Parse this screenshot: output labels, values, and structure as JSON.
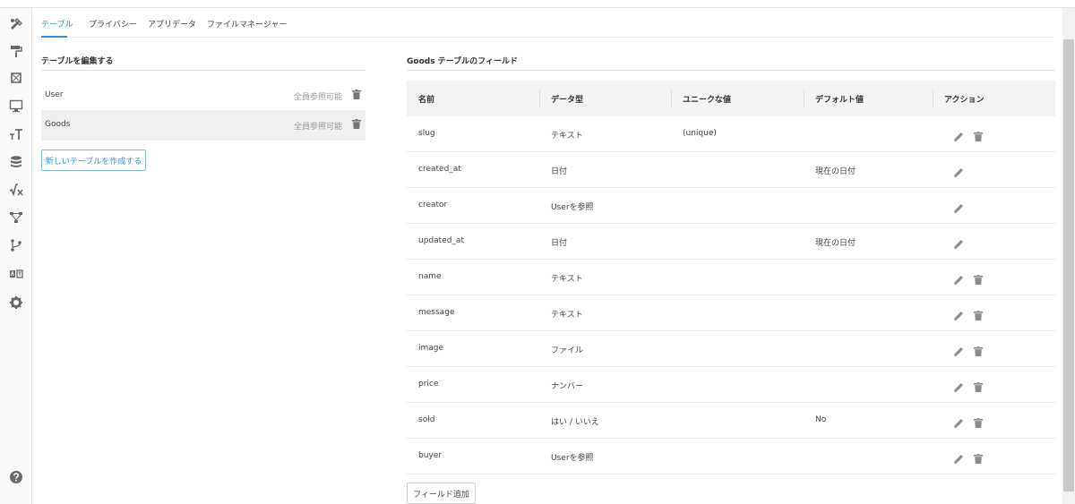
{
  "tabs": [
    "テーブル",
    "プライバシー",
    "アプリデータ",
    "ファイルマネージャー"
  ],
  "sidebar": {
    "icons": [
      "design-tools-icon",
      "paint-roller-icon",
      "crop-icon",
      "monitor-icon",
      "text-size-icon",
      "database-icon",
      "formula-icon",
      "workflow-icon",
      "branch-icon",
      "translate-icon",
      "gear-icon",
      "help-icon"
    ]
  },
  "left": {
    "title": "テーブルを編集する",
    "tables": [
      {
        "name": "User",
        "permission": "全員参照可能"
      },
      {
        "name": "Goods",
        "permission": "全員参照可能"
      }
    ],
    "new_button": "新しいテーブルを作成する"
  },
  "right": {
    "title": "Goods テーブルのフィールド",
    "headers": [
      "名前",
      "データ型",
      "ユニークな値",
      "デフォルト値",
      "アクション"
    ],
    "fields": [
      {
        "name": "slug",
        "type": "テキスト",
        "unique": "(unique)",
        "default": "",
        "deletable": true
      },
      {
        "name": "created_at",
        "type": "日付",
        "unique": "",
        "default": "現在の日付",
        "deletable": false
      },
      {
        "name": "creator",
        "type": "Userを参照",
        "unique": "",
        "default": "",
        "deletable": false
      },
      {
        "name": "updated_at",
        "type": "日付",
        "unique": "",
        "default": "現在の日付",
        "deletable": false
      },
      {
        "name": "name",
        "type": "テキスト",
        "unique": "",
        "default": "",
        "deletable": true
      },
      {
        "name": "message",
        "type": "テキスト",
        "unique": "",
        "default": "",
        "deletable": true
      },
      {
        "name": "image",
        "type": "ファイル",
        "unique": "",
        "default": "",
        "deletable": true
      },
      {
        "name": "price",
        "type": "ナンバー",
        "unique": "",
        "default": "",
        "deletable": true
      },
      {
        "name": "sold",
        "type": "はい / いいえ",
        "unique": "",
        "default": "No",
        "deletable": true
      },
      {
        "name": "buyer",
        "type": "Userを参照",
        "unique": "",
        "default": "",
        "deletable": true
      }
    ],
    "add_button": "フィールド追加"
  },
  "colors": {
    "accent": "#2f8fd8",
    "selected_row": "#efefef",
    "header_bg": "#f4f4f4"
  }
}
